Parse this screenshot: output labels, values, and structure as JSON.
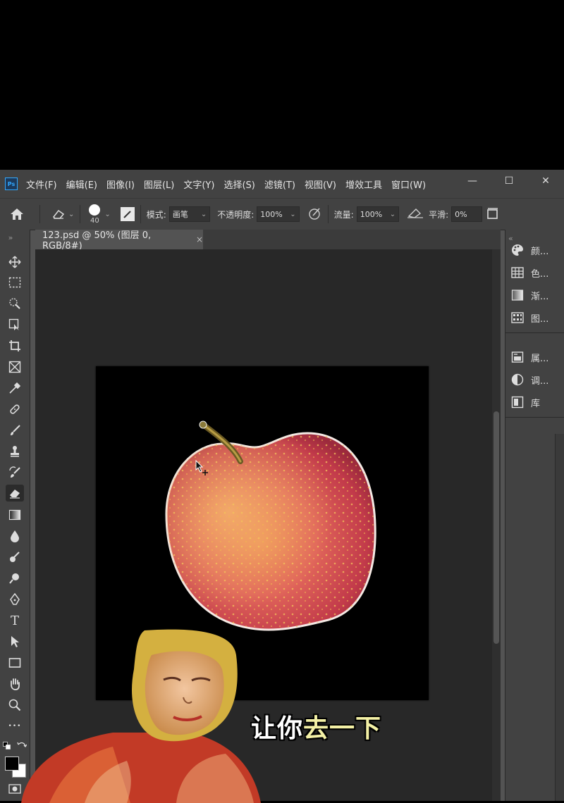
{
  "app": {
    "logo": "Ps"
  },
  "menu": [
    "文件(F)",
    "编辑(E)",
    "图像(I)",
    "图层(L)",
    "文字(Y)",
    "选择(S)",
    "滤镜(T)",
    "视图(V)",
    "增效工具",
    "窗口(W)"
  ],
  "window_controls": {
    "minimize": "—",
    "maximize": "☐",
    "close": "✕"
  },
  "options": {
    "brush_size": "40",
    "mode_label": "模式:",
    "mode_value": "画笔",
    "opacity_label": "不透明度:",
    "opacity_value": "100%",
    "flow_label": "流量:",
    "flow_value": "100%",
    "smoothing_label": "平滑:",
    "smoothing_value": "0%"
  },
  "document_tab": {
    "title": "123.psd @ 50% (图层 0, RGB/8#)",
    "close": "×"
  },
  "tools": [
    "move-tool",
    "marquee-tool",
    "quick-selection-tool",
    "object-selection-tool",
    "crop-tool",
    "frame-tool",
    "eyedropper-tool",
    "healing-brush-tool",
    "brush-tool",
    "clone-stamp-tool",
    "history-brush-tool",
    "eraser-tool",
    "gradient-tool",
    "blur-tool",
    "dodge-tool",
    "sponge-tool",
    "pen-tool",
    "type-tool",
    "path-selection-tool",
    "rectangle-tool",
    "hand-tool",
    "zoom-tool",
    "more-tools"
  ],
  "type_tool_glyph": "T",
  "more_tools_glyph": "•••",
  "right_panels": {
    "group1": [
      {
        "label": "颜...",
        "icon": "palette-icon"
      },
      {
        "label": "色...",
        "icon": "swatches-icon"
      },
      {
        "label": "渐...",
        "icon": "gradient-icon"
      },
      {
        "label": "图...",
        "icon": "patterns-icon"
      }
    ],
    "group2": [
      {
        "label": "属...",
        "icon": "properties-icon"
      },
      {
        "label": "调...",
        "icon": "adjustments-icon"
      },
      {
        "label": "库",
        "icon": "libraries-icon"
      }
    ]
  },
  "subtitle": {
    "part1": "让你",
    "part2": "去一下"
  },
  "colors": {
    "accent_ps": "#31a8ff",
    "subtitle_highlight": "#f3f0a5",
    "apple_red": "#d8444c",
    "apple_yellow": "#e9a84a"
  }
}
